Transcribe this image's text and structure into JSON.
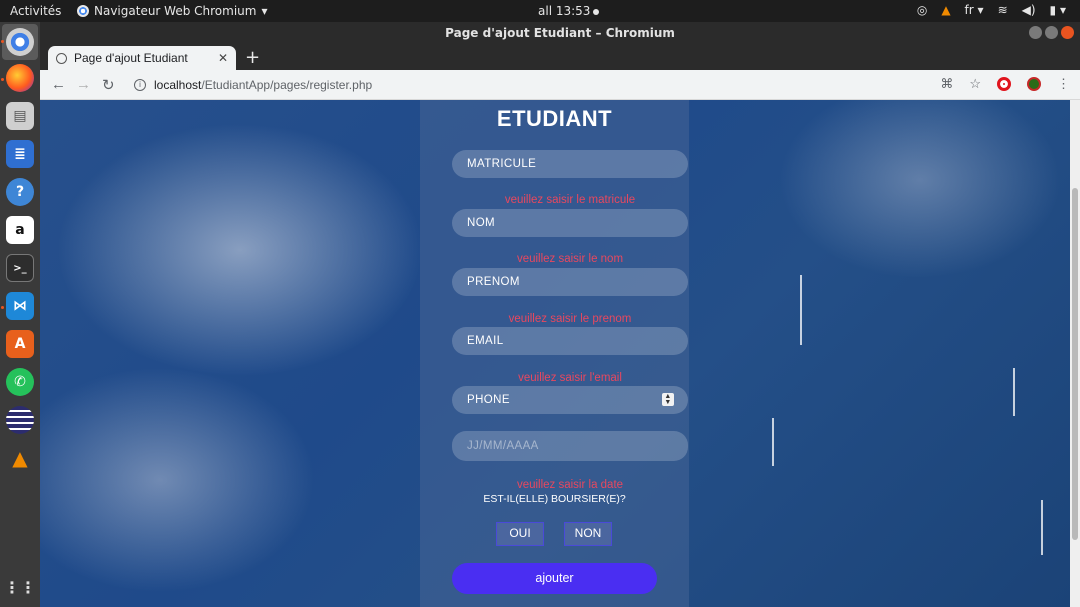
{
  "topbar": {
    "activities": "Activités",
    "app_name": "Navigateur Web Chromium",
    "clock": "all 13:53",
    "lang": "fr"
  },
  "window": {
    "title": "Page d'ajout Etudiant – Chromium"
  },
  "tab": {
    "title": "Page d'ajout Etudiant"
  },
  "address": {
    "host": "localhost",
    "path": "/EtudiantApp/pages/register.php"
  },
  "form": {
    "title": "ETUDIANT",
    "fields": {
      "matricule": "MATRICULE",
      "nom": "NOM",
      "prenom": "PRENOM",
      "email": "EMAIL",
      "phone": "PHONE",
      "date_placeholder": "JJ/MM/AAAA"
    },
    "errors": {
      "matricule": "veuillez saisir le matricule",
      "nom": "veuillez saisir le nom",
      "prenom": "veuillez saisir le prenom",
      "email": "veuillez saisir l'email",
      "date": "veuillez saisir la date"
    },
    "question": "EST-IL(ELLE) BOURSIER(E)?",
    "yes_label": "OUI",
    "no_label": "NON",
    "submit_label": "ajouter"
  },
  "colors": {
    "submit": "#4a2ef2",
    "error": "#e8485f",
    "accent": "#e95420"
  }
}
